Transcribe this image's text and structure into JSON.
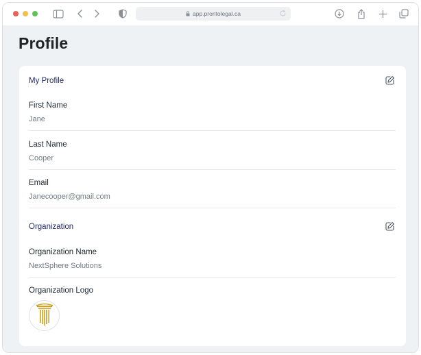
{
  "browser": {
    "url": "app.prontolegal.ca"
  },
  "page": {
    "title": "Profile"
  },
  "my_profile": {
    "section_title": "My Profile",
    "fields": [
      {
        "label": "First Name",
        "value": "Jane"
      },
      {
        "label": "Last Name",
        "value": "Cooper"
      },
      {
        "label": "Email",
        "value": "Janecooper@gmail.com"
      }
    ]
  },
  "organization": {
    "section_title": "Organization",
    "name_label": "Organization Name",
    "name_value": "NextSphere Solutions",
    "logo_label": "Organization Logo"
  },
  "colors": {
    "accent_title": "#1f2a6b",
    "logo_gold": "#c9a227",
    "background": "#eff2f4"
  },
  "icons": [
    "sidebar-icon",
    "back-icon",
    "forward-icon",
    "shield-icon",
    "lock-icon",
    "reload-icon",
    "download-icon",
    "share-icon",
    "new-tab-icon",
    "tabs-icon",
    "edit-icon",
    "pillar-logo-icon"
  ]
}
